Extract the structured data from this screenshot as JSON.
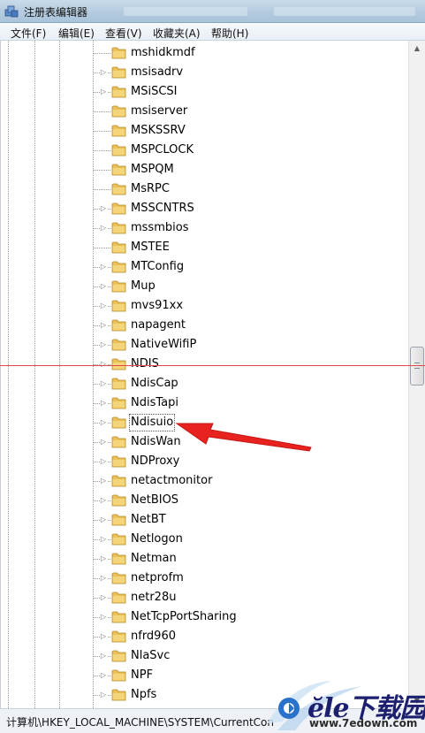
{
  "window": {
    "title": "注册表编辑器",
    "icon": "registry-editor-icon"
  },
  "menu": [
    "文件(F)",
    "编辑(E)",
    "查看(V)",
    "收藏夹(A)",
    "帮助(H)"
  ],
  "tree": {
    "items": [
      {
        "label": "mshidkmdf",
        "expandable": false
      },
      {
        "label": "msisadrv",
        "expandable": true
      },
      {
        "label": "MSiSCSI",
        "expandable": true
      },
      {
        "label": "msiserver",
        "expandable": false
      },
      {
        "label": "MSKSSRV",
        "expandable": false
      },
      {
        "label": "MSPCLOCK",
        "expandable": false
      },
      {
        "label": "MSPQM",
        "expandable": false
      },
      {
        "label": "MsRPC",
        "expandable": false
      },
      {
        "label": "MSSCNTRS",
        "expandable": true
      },
      {
        "label": "mssmbios",
        "expandable": true
      },
      {
        "label": "MSTEE",
        "expandable": false
      },
      {
        "label": "MTConfig",
        "expandable": true
      },
      {
        "label": "Mup",
        "expandable": true
      },
      {
        "label": "mvs91xx",
        "expandable": true
      },
      {
        "label": "napagent",
        "expandable": true
      },
      {
        "label": "NativeWifiP",
        "expandable": true
      },
      {
        "label": "NDIS",
        "expandable": true
      },
      {
        "label": "NdisCap",
        "expandable": true
      },
      {
        "label": "NdisTapi",
        "expandable": true
      },
      {
        "label": "Ndisuio",
        "expandable": true,
        "selected": true
      },
      {
        "label": "NdisWan",
        "expandable": true
      },
      {
        "label": "NDProxy",
        "expandable": true
      },
      {
        "label": "netactmonitor",
        "expandable": true
      },
      {
        "label": "NetBIOS",
        "expandable": true
      },
      {
        "label": "NetBT",
        "expandable": true
      },
      {
        "label": "Netlogon",
        "expandable": true
      },
      {
        "label": "Netman",
        "expandable": true
      },
      {
        "label": "netprofm",
        "expandable": true
      },
      {
        "label": "netr28u",
        "expandable": true
      },
      {
        "label": "NetTcpPortSharing",
        "expandable": true
      },
      {
        "label": "nfrd960",
        "expandable": true
      },
      {
        "label": "NlaSvc",
        "expandable": true
      },
      {
        "label": "NPF",
        "expandable": true
      },
      {
        "label": "Npfs",
        "expandable": true
      }
    ]
  },
  "statusbar": {
    "path": "计算机\\HKEY_LOCAL_MACHINE\\SYSTEM\\CurrentCon"
  },
  "watermark": {
    "brand": "ĕle下载园",
    "url": "www.7edown.com"
  },
  "colors": {
    "folder": "#e9c15a",
    "annotation": "#e8231f"
  }
}
